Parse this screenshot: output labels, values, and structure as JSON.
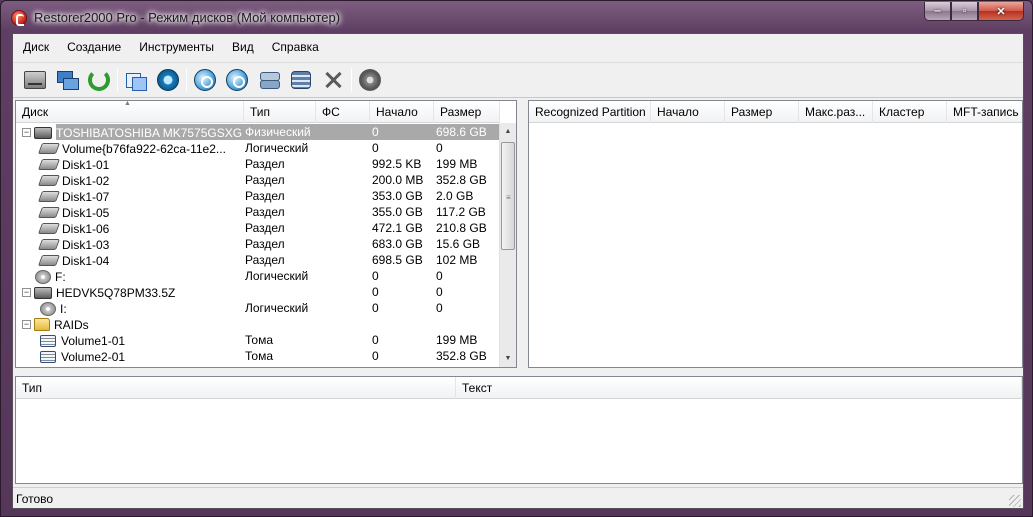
{
  "window": {
    "title": "Restorer2000 Pro - Режим дисков (Мой компьютер)",
    "caption_buttons": [
      "minimize",
      "maximize",
      "close"
    ]
  },
  "menu": [
    "Диск",
    "Создание",
    "Инструменты",
    "Вид",
    "Справка"
  ],
  "toolbar": {
    "icons": [
      "local-drive-icon",
      "network-drive-icon",
      "refresh-icon",
      "copy-icon",
      "scan-icon",
      "find-icon",
      "find-alt-icon",
      "stack-icon",
      "disk-array-icon",
      "close-icon",
      "settings-icon"
    ]
  },
  "disk_pane": {
    "columns": [
      "Диск",
      "Тип",
      "ФС",
      "Начало",
      "Размер"
    ],
    "rows": [
      {
        "name": "TOSHIBATOSHIBA MK7575GSXG...",
        "type": "Физический",
        "fs": "",
        "start": "0",
        "size": "698.6 GB",
        "kind": "physical",
        "level": 0,
        "expander": "−",
        "selected": true
      },
      {
        "name": "Volume{b76fa922-62ca-11e2...",
        "type": "Логический",
        "fs": "",
        "start": "0",
        "size": "0",
        "kind": "hdd",
        "level": 1
      },
      {
        "name": "Disk1-01",
        "type": "Раздел",
        "fs": "",
        "start": "992.5 KB",
        "size": "199 MB",
        "kind": "hdd",
        "level": 1
      },
      {
        "name": "Disk1-02",
        "type": "Раздел",
        "fs": "",
        "start": "200.0 MB",
        "size": "352.8 GB",
        "kind": "hdd",
        "level": 1
      },
      {
        "name": "Disk1-07",
        "type": "Раздел",
        "fs": "",
        "start": "353.0 GB",
        "size": "2.0 GB",
        "kind": "hdd",
        "level": 1
      },
      {
        "name": "Disk1-05",
        "type": "Раздел",
        "fs": "",
        "start": "355.0 GB",
        "size": "117.2 GB",
        "kind": "hdd",
        "level": 1
      },
      {
        "name": "Disk1-06",
        "type": "Раздел",
        "fs": "",
        "start": "472.1 GB",
        "size": "210.8 GB",
        "kind": "hdd",
        "level": 1
      },
      {
        "name": "Disk1-03",
        "type": "Раздел",
        "fs": "",
        "start": "683.0 GB",
        "size": "15.6 GB",
        "kind": "hdd",
        "level": 1
      },
      {
        "name": "Disk1-04",
        "type": "Раздел",
        "fs": "",
        "start": "698.5 GB",
        "size": "102 MB",
        "kind": "hdd",
        "level": 1
      },
      {
        "name": "F:",
        "type": "Логический",
        "fs": "",
        "start": "0",
        "size": "0",
        "kind": "cd",
        "level": 0
      },
      {
        "name": "HEDVK5Q78PM33.5Z",
        "type": "",
        "fs": "",
        "start": "0",
        "size": "0",
        "kind": "physical",
        "level": 0,
        "expander": "−"
      },
      {
        "name": "I:",
        "type": "Логический",
        "fs": "",
        "start": "0",
        "size": "0",
        "kind": "cd",
        "level": 1
      },
      {
        "name": "RAIDs",
        "type": "",
        "fs": "",
        "start": "",
        "size": "",
        "kind": "folder",
        "level": 0,
        "expander": "−"
      },
      {
        "name": "Volume1-01",
        "type": "Тома",
        "fs": "",
        "start": "0",
        "size": "199 MB",
        "kind": "volume",
        "level": 1
      },
      {
        "name": "Volume2-01",
        "type": "Тома",
        "fs": "",
        "start": "0",
        "size": "352.8 GB",
        "kind": "volume",
        "level": 1
      }
    ]
  },
  "partition_pane": {
    "columns": [
      "Recognized Partition",
      "Начало",
      "Размер",
      "Макс.раз...",
      "Кластер",
      "MFT-запись"
    ]
  },
  "log_pane": {
    "columns": [
      "Тип",
      "Текст"
    ]
  },
  "status": {
    "text": "Готово"
  }
}
